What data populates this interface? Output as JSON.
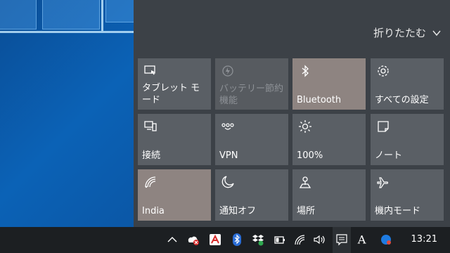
{
  "panel": {
    "collapse_label": "折りたたむ"
  },
  "tiles": [
    {
      "label": "タブレット モード",
      "icon": "tablet-mode-icon",
      "state": "normal"
    },
    {
      "label": "バッテリー節約機能",
      "icon": "battery-saver-icon",
      "state": "disabled"
    },
    {
      "label": "Bluetooth",
      "icon": "bluetooth-icon",
      "state": "active"
    },
    {
      "label": "すべての設定",
      "icon": "gear-icon",
      "state": "normal"
    },
    {
      "label": "接続",
      "icon": "connect-icon",
      "state": "normal"
    },
    {
      "label": "VPN",
      "icon": "vpn-icon",
      "state": "normal"
    },
    {
      "label": "100%",
      "icon": "brightness-icon",
      "state": "normal"
    },
    {
      "label": "ノート",
      "icon": "note-icon",
      "state": "normal"
    },
    {
      "label": "India",
      "icon": "wifi-icon",
      "state": "active"
    },
    {
      "label": "通知オフ",
      "icon": "moon-icon",
      "state": "normal"
    },
    {
      "label": "場所",
      "icon": "location-icon",
      "state": "normal"
    },
    {
      "label": "機内モード",
      "icon": "airplane-icon",
      "state": "normal"
    }
  ],
  "taskbar": {
    "clock": "13:21",
    "tray_icons": [
      "chevron-up-icon",
      "onedrive-error-icon",
      "avira-icon",
      "bluetooth-tray-icon",
      "dropbox-icon",
      "battery-icon",
      "wifi-tray-icon",
      "volume-icon",
      "action-center-icon",
      "text-a-icon",
      "profile-icon"
    ]
  },
  "colors": {
    "panel": "#3c4147",
    "tile": "#5a5f65",
    "tile_active": "#8e8481",
    "taskbar": "#1c1f22",
    "desktop": "#0a5ea8"
  }
}
